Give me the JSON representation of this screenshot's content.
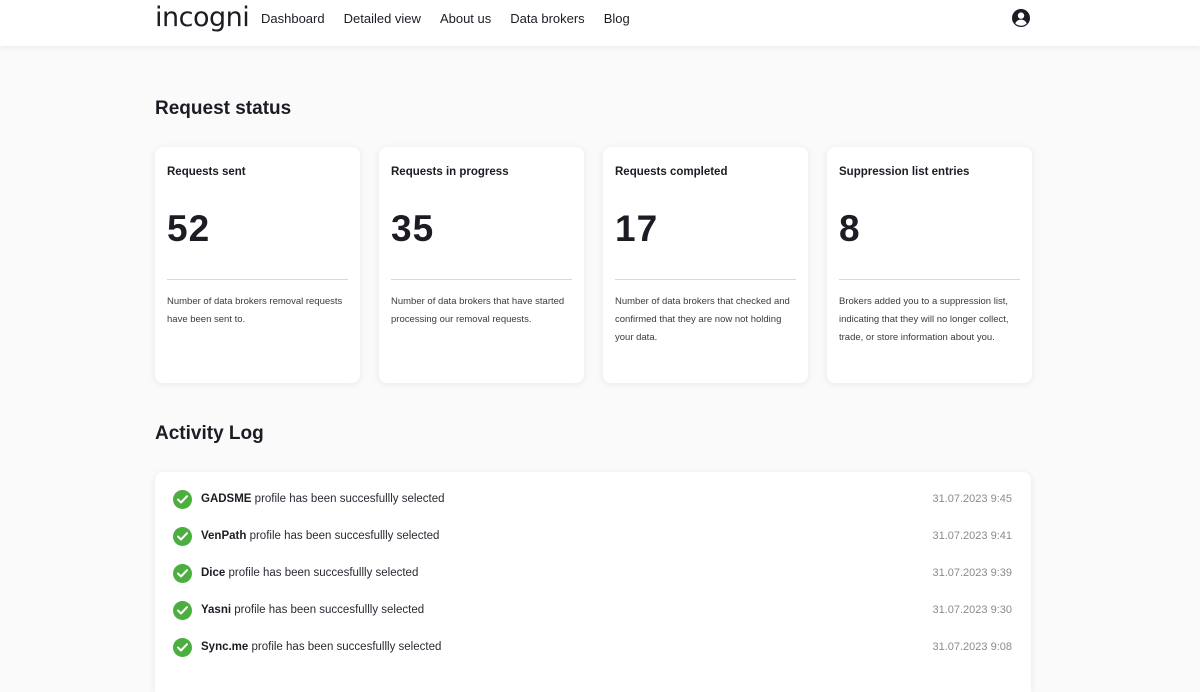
{
  "header": {
    "logo": "incogni",
    "nav": [
      "Dashboard",
      "Detailed view",
      "About us",
      "Data brokers",
      "Blog"
    ],
    "account_icon": "user-circle-icon"
  },
  "request_status": {
    "title": "Request status",
    "cards": [
      {
        "title": "Requests sent",
        "value": "52",
        "description": "Number of data brokers removal requests have been sent to."
      },
      {
        "title": "Requests in progress",
        "value": "35",
        "description": "Number of data brokers that have started processing our removal requests."
      },
      {
        "title": "Requests completed",
        "value": "17",
        "description": "Number of data brokers that checked and confirmed that they are now not holding your data."
      },
      {
        "title": "Suppression list entries",
        "value": "8",
        "description": "Brokers added you to a suppression list, indicating that they will no longer collect, trade, or store information about you."
      }
    ]
  },
  "activity_log": {
    "title": "Activity Log",
    "entries": [
      {
        "broker": "GADSME",
        "text": " profile has been succesfullly selected",
        "time": "31.07.2023 9:45"
      },
      {
        "broker": "VenPath",
        "text": " profile has been succesfullly selected",
        "time": "31.07.2023 9:41"
      },
      {
        "broker": "Dice",
        "text": " profile has been succesfullly selected",
        "time": "31.07.2023 9:39"
      },
      {
        "broker": "Yasni",
        "text": " profile has been succesfullly selected",
        "time": "31.07.2023 9:30"
      },
      {
        "broker": "Sync.me",
        "text": " profile has been succesfullly selected",
        "time": "31.07.2023 9:08"
      }
    ]
  },
  "colors": {
    "accent_green": "#4cae3e",
    "text_dark": "#1c1c24",
    "muted": "#8a8a92",
    "background": "#fafafa"
  }
}
